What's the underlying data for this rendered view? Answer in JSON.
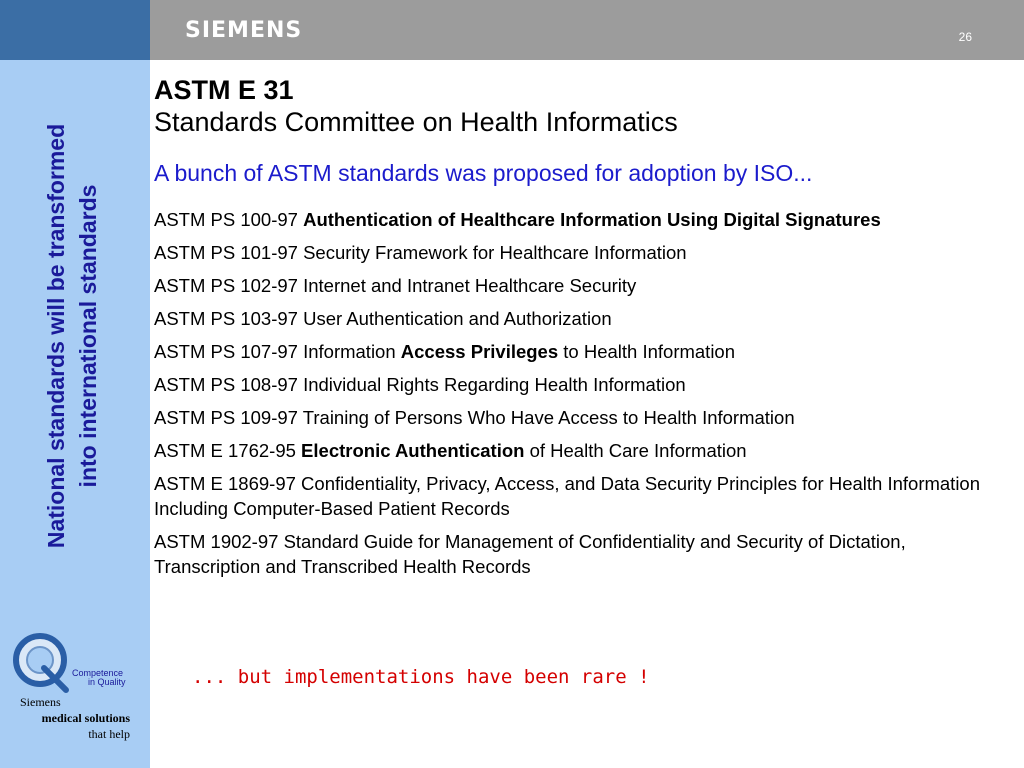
{
  "header": {
    "brand": "SIEMENS",
    "page_number": "26"
  },
  "sidebar": {
    "vertical_line1": "National standards will be transformed",
    "vertical_line2": "into international standards",
    "logo_text_top": "Competence",
    "logo_text_bottom": "in Quality",
    "caption_line1": "Siemens",
    "caption_line2": "medical solutions",
    "caption_line3": "that help"
  },
  "main": {
    "title": "ASTM E 31",
    "subtitle": "Standards Committee on Health Informatics",
    "highlight": "A bunch of ASTM standards was proposed for adoption by ISO...",
    "items": [
      {
        "prefix": "ASTM PS 100-97 ",
        "bold": "Authentication of Healthcare Information Using Digital Signatures",
        "suffix": ""
      },
      {
        "prefix": "ASTM PS 101-97 Security Framework for Healthcare Information",
        "bold": "",
        "suffix": ""
      },
      {
        "prefix": "ASTM PS 102-97 Internet and Intranet Healthcare Security",
        "bold": "",
        "suffix": ""
      },
      {
        "prefix": "ASTM PS 103-97 User Authentication and Authorization",
        "bold": "",
        "suffix": ""
      },
      {
        "prefix": "ASTM PS 107-97  Information ",
        "bold": "Access Privileges",
        "suffix": " to Health Information"
      },
      {
        "prefix": "ASTM PS 108-97 Individual Rights Regarding Health Information",
        "bold": "",
        "suffix": ""
      },
      {
        "prefix": "ASTM PS 109-97 Training of Persons Who Have Access to Health Information",
        "bold": "",
        "suffix": ""
      },
      {
        "prefix": "ASTM E 1762-95 ",
        "bold": "Electronic Authentication",
        "suffix": " of Health Care Information"
      },
      {
        "prefix": "ASTM E 1869-97     Confidentiality, Privacy, Access, and Data Security Principles for Health Information Including Computer-Based Patient Records",
        "bold": "",
        "suffix": ""
      },
      {
        "prefix": "ASTM 1902-97 Standard Guide for Management of Confidentiality and Security of Dictation, Transcription and Transcribed Health Records",
        "bold": "",
        "suffix": ""
      }
    ],
    "closing": "... but implementations have been rare !"
  },
  "colors": {
    "header_blue": "#3b6ea5",
    "header_gray": "#9c9c9c",
    "sidebar_bg": "#a8cdf4",
    "vertical_text": "#1a1a9a",
    "highlight_blue": "#1b1bcc",
    "closing_red": "#d40000"
  }
}
